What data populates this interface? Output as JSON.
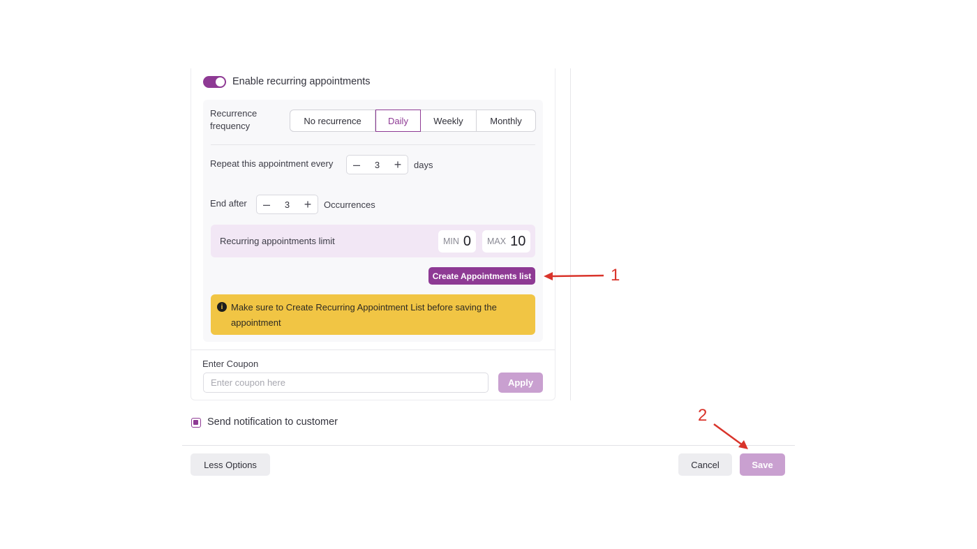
{
  "recurring": {
    "toggle_label": "Enable recurring appointments",
    "enabled": true,
    "frequency_label": "Recurrence frequency",
    "frequency_options": [
      "No recurrence",
      "Daily",
      "Weekly",
      "Monthly"
    ],
    "frequency_selected": "Daily",
    "repeat_label": "Repeat this appointment every",
    "repeat_value": "3",
    "repeat_unit": "days",
    "end_label": "End after",
    "end_value": "3",
    "end_unit": "Occurrences",
    "limit_label": "Recurring appointments limit",
    "min_label": "MIN",
    "min_value": "0",
    "max_label": "MAX",
    "max_value": "10",
    "create_button": "Create Appointments list",
    "warning_icon": "info-icon",
    "warning_text": "Make sure to Create Recurring Appointment List before saving the appointment"
  },
  "coupon": {
    "label": "Enter Coupon",
    "placeholder": "Enter coupon here",
    "value": "",
    "apply_button": "Apply"
  },
  "notification": {
    "label": "Send notification to customer",
    "checked": true
  },
  "footer": {
    "less_options": "Less Options",
    "cancel": "Cancel",
    "save": "Save"
  },
  "annotations": {
    "one": "1",
    "two": "2",
    "color": "#d9342b"
  },
  "colors": {
    "accent": "#8e3a94",
    "accent_light": "#c9a0d0",
    "warning": "#f1c544",
    "limit_bg": "#f2e7f5"
  }
}
